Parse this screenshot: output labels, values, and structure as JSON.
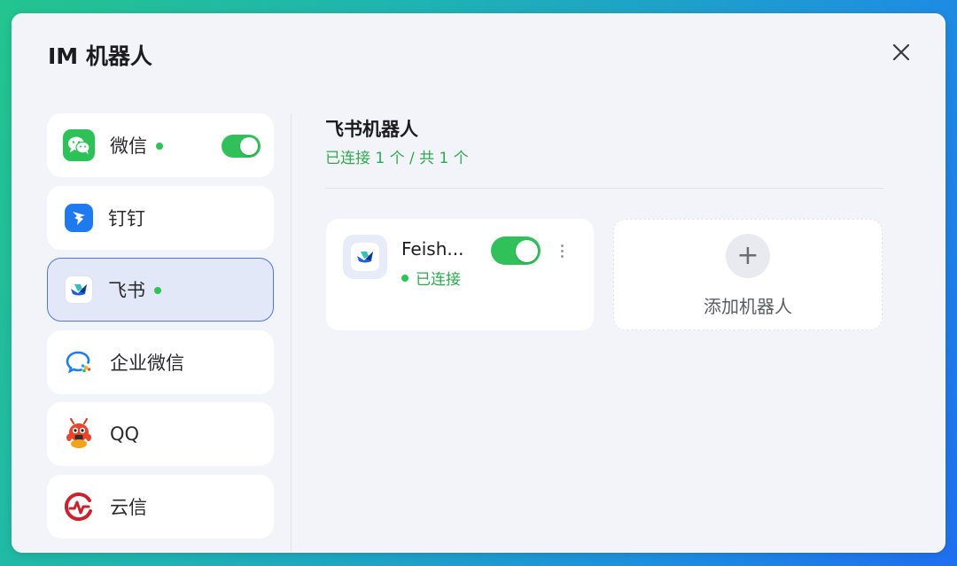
{
  "dialog": {
    "title": "IM 机器人"
  },
  "sidebar": {
    "items": [
      {
        "label": "微信",
        "connected": true,
        "toggle_on": true,
        "icon": "wechat-icon"
      },
      {
        "label": "钉钉",
        "connected": false,
        "icon": "dingtalk-icon"
      },
      {
        "label": "飞书",
        "connected": true,
        "active": true,
        "icon": "feishu-icon"
      },
      {
        "label": "企业微信",
        "connected": false,
        "icon": "wecom-icon"
      },
      {
        "label": "QQ",
        "connected": false,
        "icon": "qq-icon"
      },
      {
        "label": "云信",
        "connected": false,
        "icon": "yunxin-icon"
      }
    ]
  },
  "panel": {
    "title": "飞书机器人",
    "subtitle": "已连接 1 个 / 共 1 个"
  },
  "bot_card": {
    "name": "Feish...",
    "status": "已连接",
    "toggle_on": true
  },
  "add_card": {
    "plus": "+",
    "label": "添加机器人"
  },
  "colors": {
    "accent_green": "#30c15a",
    "active_border": "#4f74e8",
    "active_bg": "#e3e8f8"
  }
}
